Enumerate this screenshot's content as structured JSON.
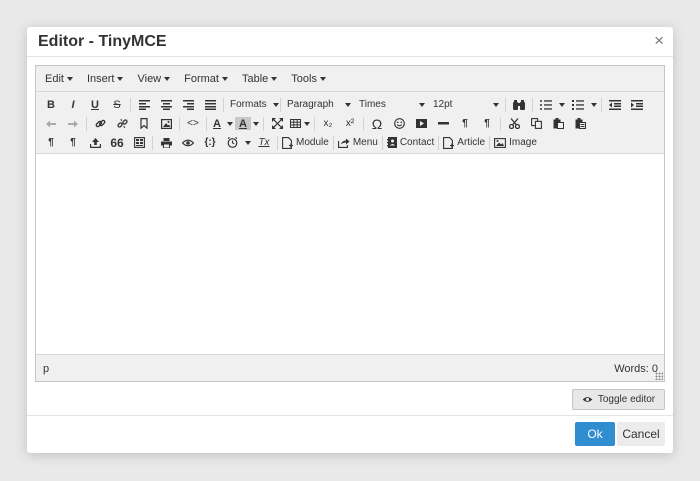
{
  "dialog": {
    "title": "Editor - TinyMCE",
    "close_label": "×"
  },
  "menubar": {
    "items": [
      "Edit",
      "Insert",
      "View",
      "Format",
      "Table",
      "Tools"
    ]
  },
  "toolbar": {
    "formats_label": "Formats",
    "block_format": "Paragraph",
    "font_family": "Times",
    "font_size": "12pt",
    "module_label": "Module",
    "menu_label": "Menu",
    "contact_label": "Contact",
    "article_label": "Article",
    "image_label": "Image",
    "bold": "B",
    "italic": "I",
    "underline": "U",
    "strikethrough": "S",
    "text_color": "A",
    "bg_color": "A",
    "omega": "Ω",
    "code": "<>",
    "variables": "{:}",
    "clear_format": "Tx",
    "subscript": "x₂",
    "superscript": "x²",
    "blockquote": "66",
    "pilcrow": "¶"
  },
  "statusbar": {
    "path": "p",
    "word_count": "Words: 0"
  },
  "footer": {
    "toggle_label": "Toggle editor",
    "ok_label": "Ok",
    "cancel_label": "Cancel"
  },
  "colors": {
    "accent": "#2f8dd0",
    "toolbar_bg": "#f0f0f0"
  }
}
